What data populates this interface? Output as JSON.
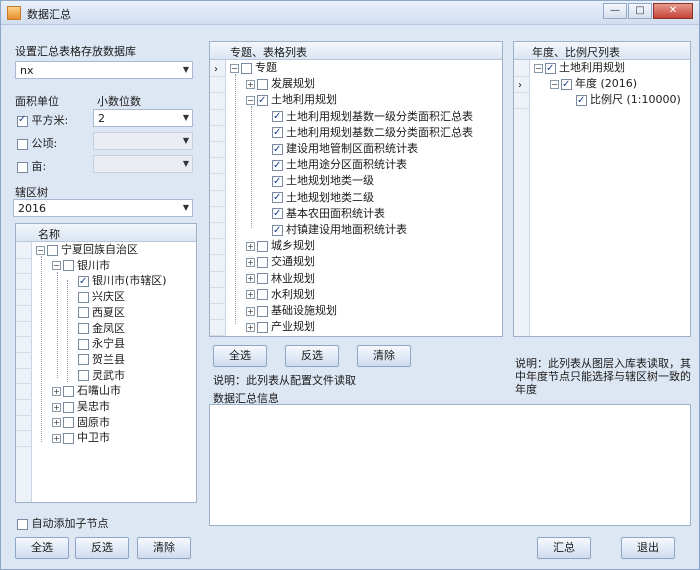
{
  "window": {
    "title": "数据汇总"
  },
  "left": {
    "db_label": "设置汇总表格存放数据库",
    "db_value": "nx",
    "area_unit_label": "面积单位",
    "decimals_label": "小数位数",
    "units": [
      {
        "label": "平方米:",
        "checked": true,
        "decimals": "2"
      },
      {
        "label": "公顷:",
        "checked": false,
        "decimals": ""
      },
      {
        "label": "亩:",
        "checked": false,
        "decimals": ""
      }
    ],
    "tree_label": "辖区树",
    "year_value": "2016",
    "tree_header": "名称",
    "tree": [
      {
        "text": "宁夏回族自治区",
        "checked": false,
        "pm": "−"
      },
      {
        "text": "银川市",
        "checked": false,
        "pm": "−"
      },
      {
        "text": "银川市(市辖区)",
        "checked": true,
        "pm": ""
      },
      {
        "text": "兴庆区",
        "checked": false,
        "pm": ""
      },
      {
        "text": "西夏区",
        "checked": false,
        "pm": ""
      },
      {
        "text": "金凤区",
        "checked": false,
        "pm": ""
      },
      {
        "text": "永宁县",
        "checked": false,
        "pm": ""
      },
      {
        "text": "贺兰县",
        "checked": false,
        "pm": ""
      },
      {
        "text": "灵武市",
        "checked": false,
        "pm": ""
      },
      {
        "text": "石嘴山市",
        "checked": false,
        "pm": "+"
      },
      {
        "text": "吴忠市",
        "checked": false,
        "pm": "+"
      },
      {
        "text": "固原市",
        "checked": false,
        "pm": "+"
      },
      {
        "text": "中卫市",
        "checked": false,
        "pm": "+"
      }
    ],
    "auto_add_label": "自动添加子节点",
    "select_all": "全选",
    "invert": "反选",
    "clear": "清除"
  },
  "middle": {
    "header": "专题、表格列表",
    "tree": [
      {
        "text": "专题",
        "checked": false,
        "pm": "−"
      },
      {
        "text": "发展规划",
        "checked": false,
        "pm": "+"
      },
      {
        "text": "土地利用规划",
        "checked": true,
        "pm": "−"
      },
      {
        "text": "土地利用规划基数一级分类面积汇总表",
        "checked": true,
        "pm": ""
      },
      {
        "text": "土地利用规划基数二级分类面积汇总表",
        "checked": true,
        "pm": ""
      },
      {
        "text": "建设用地管制区面积统计表",
        "checked": true,
        "pm": ""
      },
      {
        "text": "土地用途分区面积统计表",
        "checked": true,
        "pm": ""
      },
      {
        "text": "土地规划地类一级",
        "checked": true,
        "pm": ""
      },
      {
        "text": "土地规划地类二级",
        "checked": true,
        "pm": ""
      },
      {
        "text": "基本农田面积统计表",
        "checked": true,
        "pm": ""
      },
      {
        "text": "村镇建设用地面积统计表",
        "checked": true,
        "pm": ""
      },
      {
        "text": "城乡规划",
        "checked": false,
        "pm": "+"
      },
      {
        "text": "交通规划",
        "checked": false,
        "pm": "+"
      },
      {
        "text": "林业规划",
        "checked": false,
        "pm": "+"
      },
      {
        "text": "水利规划",
        "checked": false,
        "pm": "+"
      },
      {
        "text": "基础设施规划",
        "checked": false,
        "pm": "+"
      },
      {
        "text": "产业规划",
        "checked": false,
        "pm": "+"
      }
    ],
    "select_all": "全选",
    "invert": "反选",
    "clear": "清除",
    "note": "说明：此列表从配置文件读取",
    "info_label": "数据汇总信息"
  },
  "right": {
    "header": "年度、比例尺列表",
    "tree": [
      {
        "text": "土地利用规划",
        "checked": true,
        "pm": "−"
      },
      {
        "text": "年度 (2016)",
        "checked": true,
        "pm": "−"
      },
      {
        "text": "比例尺 (1:10000)",
        "checked": true,
        "pm": ""
      }
    ],
    "note": "说明：此列表从图层入库表读取，其中年度节点只能选择与辖区树一致的年度"
  },
  "footer": {
    "summarize": "汇总",
    "exit": "退出"
  }
}
